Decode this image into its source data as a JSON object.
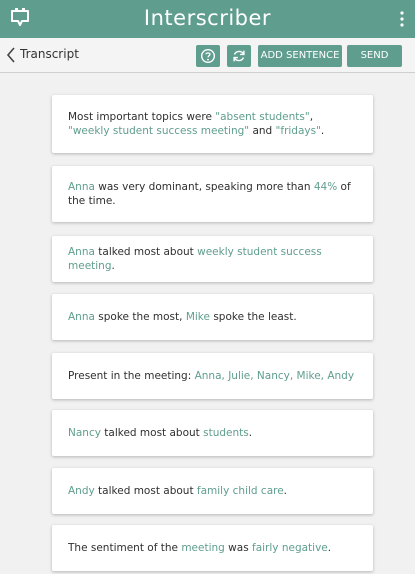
{
  "app": {
    "title": "Interscriber"
  },
  "toolbar": {
    "breadcrumb": "Transcript",
    "add_sentence_label": "ADD SENTENCE",
    "send_label": "SEND"
  },
  "colors": {
    "accent": "#5f9e8e",
    "background": "#f1f1f1",
    "card": "#ffffff"
  },
  "icons": {
    "logo": "app-logo-icon",
    "more": "more-vert-icon",
    "back": "chevron-left-icon",
    "help": "help-icon",
    "refresh": "refresh-icon"
  },
  "cards": [
    {
      "parts": [
        {
          "text": "Most important topics were "
        },
        {
          "text": "\"absent students\"",
          "hl": true
        },
        {
          "text": ", "
        },
        {
          "text": "\"weekly student success meeting\"",
          "hl": true
        },
        {
          "text": " and "
        },
        {
          "text": "\"fridays\"",
          "hl": true
        },
        {
          "text": "."
        }
      ]
    },
    {
      "parts": [
        {
          "text": "Anna",
          "hl": true
        },
        {
          "text": " was very dominant, speaking more than "
        },
        {
          "text": "44%",
          "hl": true
        },
        {
          "text": " of the time."
        }
      ]
    },
    {
      "parts": [
        {
          "text": "Anna",
          "hl": true
        },
        {
          "text": " talked most about "
        },
        {
          "text": "weekly student success meeting",
          "hl": true
        },
        {
          "text": "."
        }
      ]
    },
    {
      "parts": [
        {
          "text": "Anna",
          "hl": true
        },
        {
          "text": " spoke the most, "
        },
        {
          "text": "Mike",
          "hl": true
        },
        {
          "text": " spoke the least."
        }
      ]
    },
    {
      "parts": [
        {
          "text": "Present in the meeting: "
        },
        {
          "text": "Anna, Julie, Nancy, Mike, Andy",
          "hl": true
        }
      ]
    },
    {
      "parts": [
        {
          "text": "Nancy",
          "hl": true
        },
        {
          "text": " talked most about "
        },
        {
          "text": "students",
          "hl": true
        },
        {
          "text": "."
        }
      ]
    },
    {
      "parts": [
        {
          "text": "Andy",
          "hl": true
        },
        {
          "text": " talked most about "
        },
        {
          "text": "family child care",
          "hl": true
        },
        {
          "text": "."
        }
      ]
    },
    {
      "parts": [
        {
          "text": "The sentiment of the "
        },
        {
          "text": "meeting",
          "hl": true
        },
        {
          "text": " was "
        },
        {
          "text": "fairly negative",
          "hl": true
        },
        {
          "text": "."
        }
      ]
    }
  ]
}
